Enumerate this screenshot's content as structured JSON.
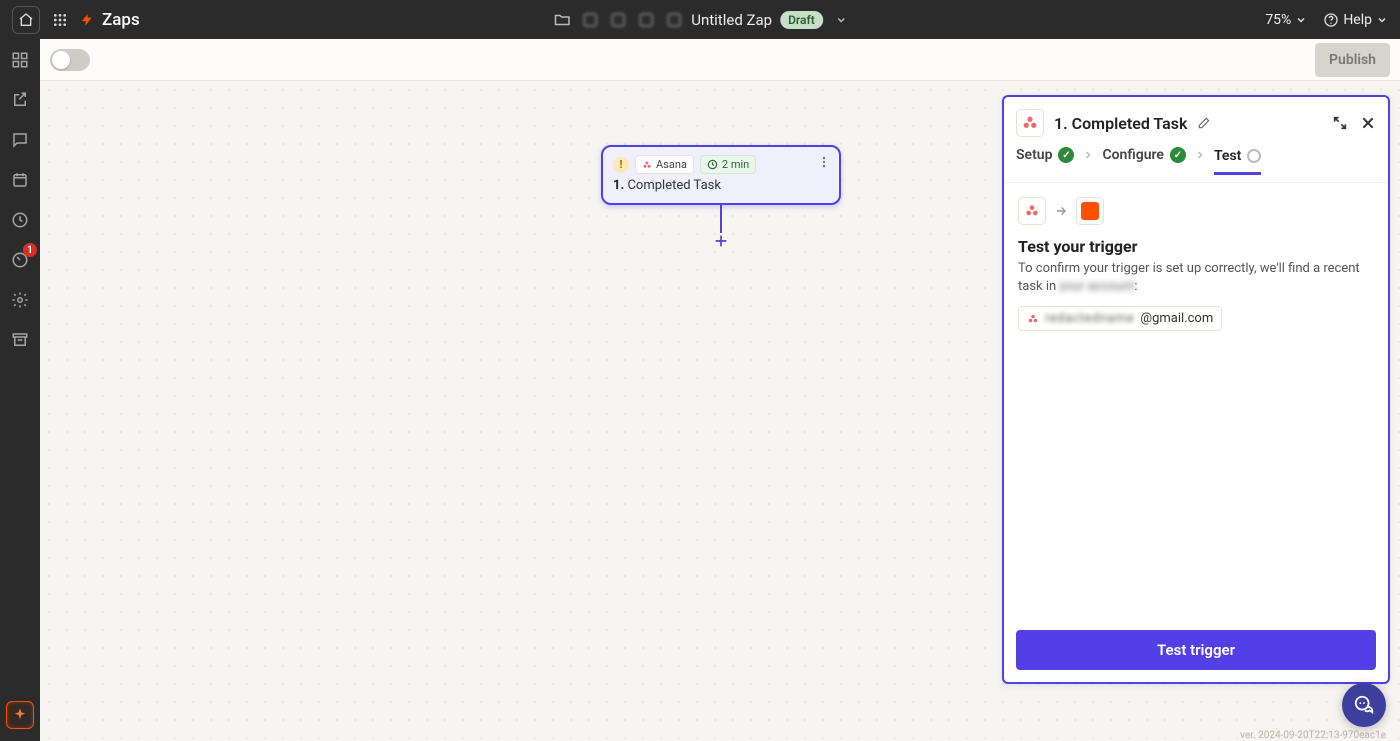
{
  "topbar": {
    "title": "Zaps",
    "zap_name": "Untitled Zap",
    "status": "Draft",
    "zoom": "75%",
    "help": "Help"
  },
  "subbar": {
    "publish": "Publish"
  },
  "left_rail": {
    "badge_count": "1"
  },
  "node": {
    "app_name": "Asana",
    "polling": "2 min",
    "step_label": "1. Completed Task",
    "step_number": "1.",
    "step_text": "Completed Task"
  },
  "panel": {
    "title": "1. Completed Task",
    "steps": {
      "setup": "Setup",
      "configure": "Configure",
      "test": "Test"
    },
    "body": {
      "heading": "Test your trigger",
      "desc_prefix": "To confirm your trigger is set up correctly, we'll find a recent task in ",
      "desc_blur": "your account",
      "desc_suffix": ":",
      "account_blur": "redactedname",
      "account_suffix": "@gmail.com"
    },
    "cta": "Test trigger"
  },
  "footer": {
    "version": "ver. 2024-09-20T22:13-970eac1e"
  }
}
